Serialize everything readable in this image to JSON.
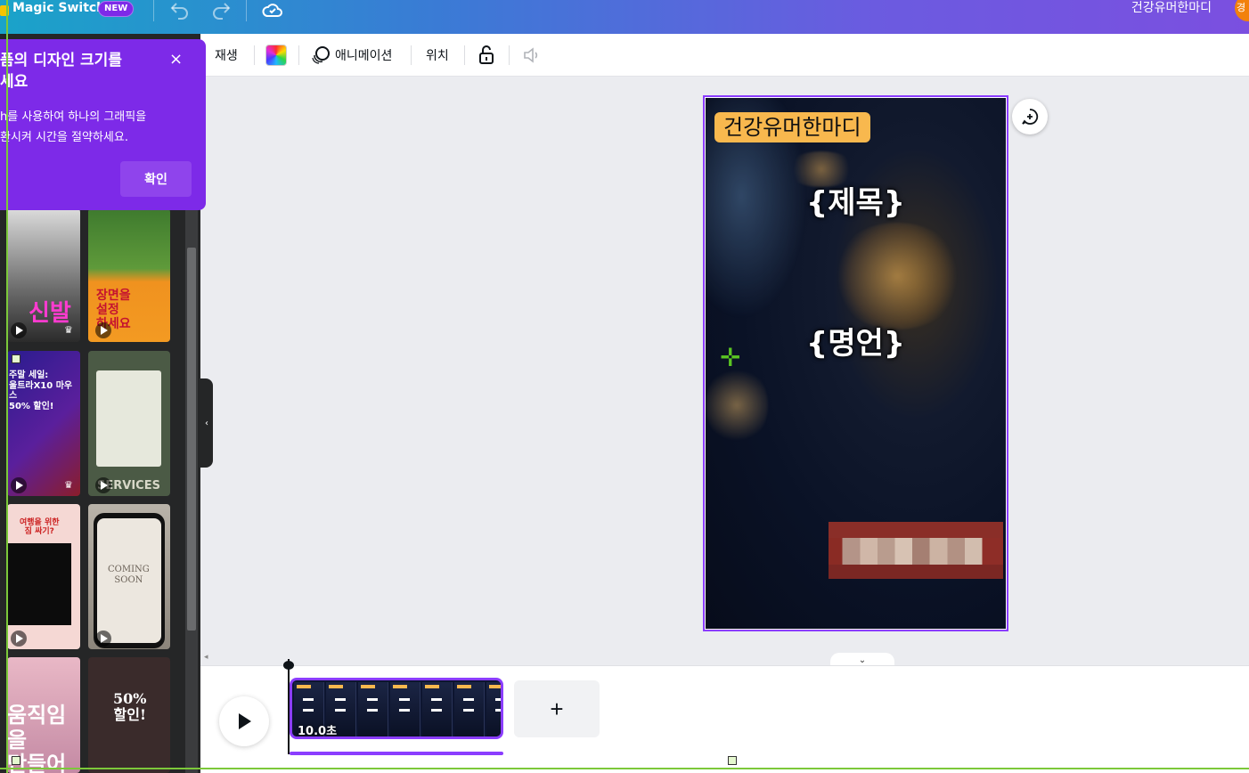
{
  "topbar": {
    "magic_switch_label": "Magic Switch",
    "new_badge": "NEW",
    "project_title": "건강유머한마디",
    "avatar_initial": "경"
  },
  "toolbar": {
    "play_label": "재생",
    "animation_label": "애니메이션",
    "position_label": "위치"
  },
  "popover": {
    "title": "폼의 디자인 크기를\n세요",
    "body": "h를 사용하여 하나의 그래픽을\n환시켜 시간을 절약하세요.",
    "confirm_label": "확인",
    "close_label": "×"
  },
  "side_panel": {
    "thumbnails": [
      {
        "text": "신발"
      },
      {
        "text": "장면을\n설정\n하세요"
      },
      {
        "text": "주말 세일:\n울트라X10 마우스\n50% 할인!"
      },
      {
        "text": "SERVICES"
      },
      {
        "text": "여행을 위한\n짐 싸기?"
      },
      {
        "text": "COMING\nSOON"
      },
      {
        "text": "움직임을\n만들어요"
      },
      {
        "text": "50%\n할인!"
      }
    ]
  },
  "design": {
    "tag": "건강유머한마디",
    "title_placeholder": "{제목}",
    "quote_placeholder": "{명언}"
  },
  "timeline": {
    "clip_duration": "10.0초",
    "add_page_label": "+"
  },
  "colors": {
    "accent": "#8b3dff",
    "popover_bg": "#7d2ae8",
    "tag_bg": "#f8b84e"
  }
}
